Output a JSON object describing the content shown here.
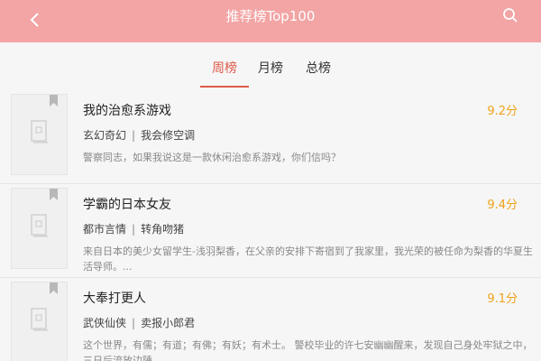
{
  "header": {
    "title": "推荐榜Top100"
  },
  "tabs": [
    {
      "label": "周榜",
      "active": true
    },
    {
      "label": "月榜",
      "active": false
    },
    {
      "label": "总榜",
      "active": false
    }
  ],
  "books": [
    {
      "title": "我的治愈系游戏",
      "score": "9.2分",
      "genre": "玄幻奇幻",
      "author": "我会修空调",
      "desc": "警察同志，如果我说这是一款休闲治愈系游戏，你们信吗？"
    },
    {
      "title": "学霸的日本女友",
      "score": "9.4分",
      "genre": "都市言情",
      "author": "转角吻猪",
      "desc": "来自日本的美少女留学生-浅羽梨香，在父亲的安排下寄宿到了我家里，我光荣的被任命为梨香的华夏生活导师。..."
    },
    {
      "title": "大奉打更人",
      "score": "9.1分",
      "genre": "武侠仙侠",
      "author": "卖报小郎君",
      "desc": "这个世界，有儒；有道；有佛；有妖；有术士。 警校毕业的许七安幽幽醒来，发现自己身处牢狱之中，三日后流放边陲....."
    }
  ],
  "colors": {
    "header": "#f3a4a4",
    "accent": "#e05a4a",
    "score": "#f0a21a"
  }
}
